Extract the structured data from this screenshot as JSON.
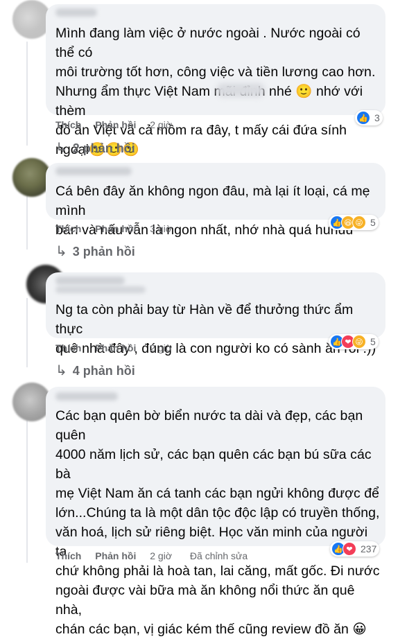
{
  "comments": [
    {
      "text": "Mình đang làm việc ở nước ngoài . Nước ngoài có thể có\nmôi trường tốt hơn, công việc và tiền lương cao hơn.\nNhưng ẩm thực Việt Nam mãi đỉnh nhé 🙂 nhớ với thèm\nđồ ăn Việt vã cả mồm ra đây, t              mấy cái đứa sính\nngoại🙂🙂🙂",
      "like_label": "Thích",
      "reply_label": "Phản hồi",
      "time": "2 giờ",
      "reaction_count": "3",
      "replies": "2 phản hồi"
    },
    {
      "text": "Cá bên đây ăn không ngon đâu, mà lại ít loại, cá mẹ mình\nbán và nấu vẫn là ngon nhất, nhớ nhà quá huhuu",
      "like_label": "Thích",
      "reply_label": "Phản hồi",
      "time": "3 giờ",
      "reaction_count": "5",
      "replies": "3 phản hồi"
    },
    {
      "text": "Ng ta còn phải bay từ Hàn về để thưởng thức ẩm thực\nquê nhà đây , đúng là con người ko có sành ăn rồi :))",
      "like_label": "Thích",
      "reply_label": "Phản hồi",
      "time": "2 giờ",
      "reaction_count": "5",
      "replies": "4 phản hồi"
    },
    {
      "text": "Các bạn quên bờ biển nước ta dài và đẹp, các bạn quên\n4000 năm lịch sử, các bạn quên các bạn bú sữa các bà\nmẹ Việt Nam ăn cá tanh các bạn ngửi không được để\nlớn...Chúng ta là một dân tộc độc lập có truyền thống,\nvăn hoá, lịch sử riêng biệt. Học văn minh của người ta\nchứ không phải là hoà tan, lai căng, mất gốc. Đi nước\nngoài được vài bữa mà ăn không nổi thức ăn quê nhà,\nchán các bạn, vị giác kém thế cũng review đồ ăn 😀",
      "like_label": "Thích",
      "reply_label": "Phản hồi",
      "time": "2 giờ",
      "edited": "Đã chỉnh sửa",
      "reaction_count": "237"
    }
  ],
  "colors": {
    "like": "#1877f2",
    "haha": "#f7b125",
    "love": "#f33e58",
    "bubble": "#f0f2f5",
    "meta": "#65676b"
  },
  "icons": {
    "reply_arrow": "↳",
    "like": "👍",
    "haha": "😆",
    "love": "❤"
  }
}
